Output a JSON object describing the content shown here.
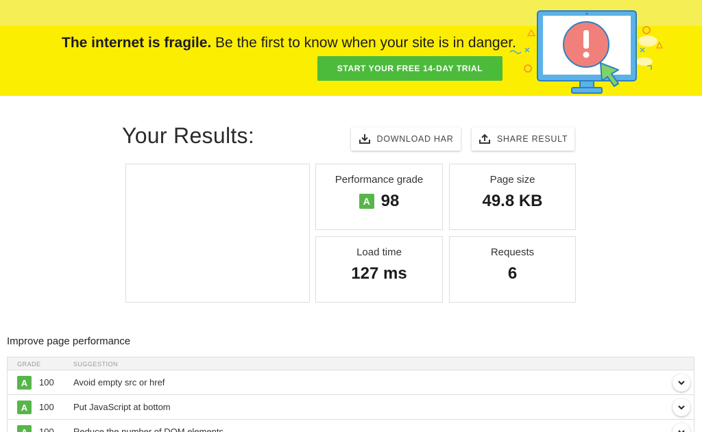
{
  "banner": {
    "headline_bold": "The internet is fragile.",
    "headline_rest": " Be the first to know when your site is in danger.",
    "cta_label": "START YOUR FREE 14-DAY TRIAL",
    "colors": {
      "banner": "#fcee00",
      "cta": "#4cbb3c"
    }
  },
  "results": {
    "title": "Your Results:",
    "download_label": "DOWNLOAD HAR",
    "share_label": "SHARE RESULT",
    "metrics": {
      "grade_label": "Performance grade",
      "grade_letter": "A",
      "grade_value": "98",
      "size_label": "Page size",
      "size_value": "49.8 KB",
      "load_label": "Load time",
      "load_value": "127 ms",
      "requests_label": "Requests",
      "requests_value": "6"
    }
  },
  "improve": {
    "title": "Improve page performance",
    "columns": {
      "grade": "GRADE",
      "suggestion": "SUGGESTION"
    },
    "rows": [
      {
        "grade": "A",
        "score": "100",
        "suggestion": "Avoid empty src or href"
      },
      {
        "grade": "A",
        "score": "100",
        "suggestion": "Put JavaScript at bottom"
      },
      {
        "grade": "A",
        "score": "100",
        "suggestion": "Reduce the number of DOM elements"
      }
    ]
  }
}
